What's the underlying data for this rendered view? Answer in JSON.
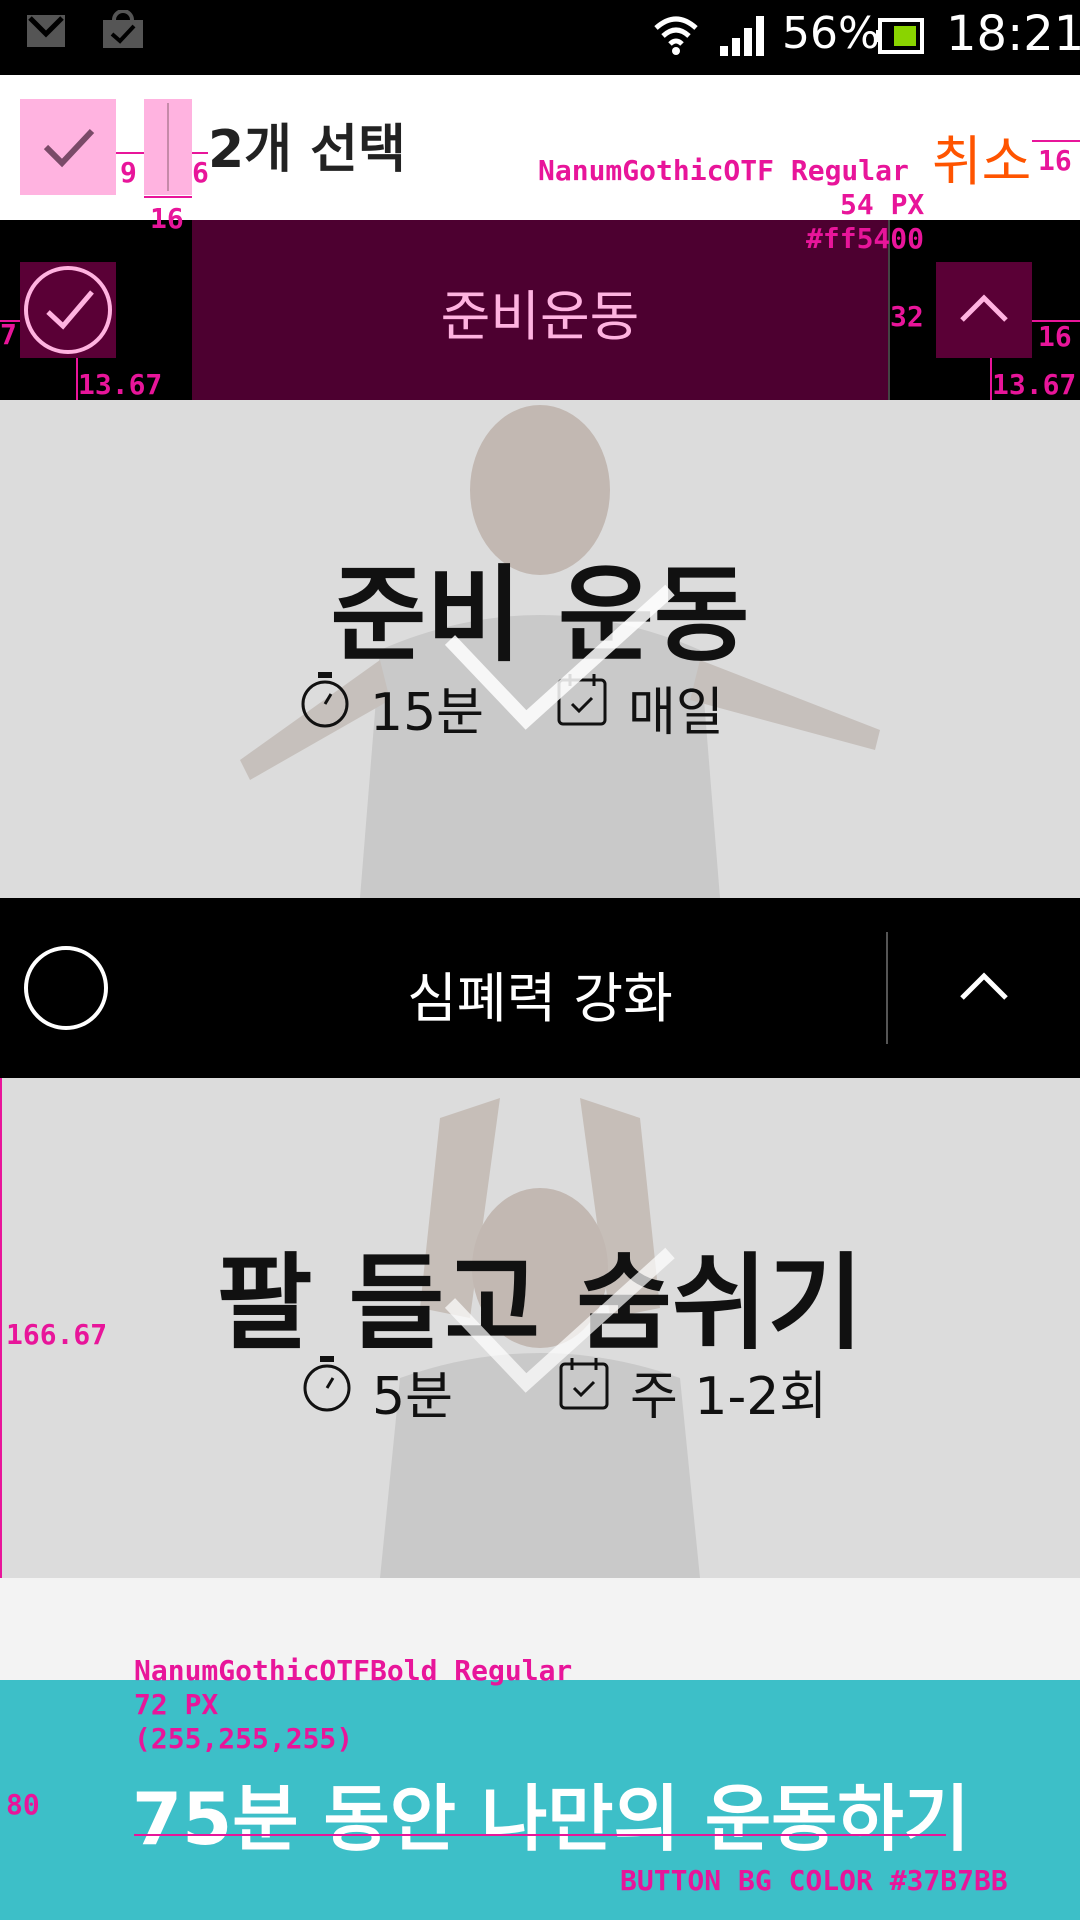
{
  "status_bar": {
    "battery": "56%",
    "time": "18:21",
    "icons": [
      "gmail-icon",
      "shopping-bag-icon",
      "wifi-icon",
      "signal-icon",
      "battery-icon"
    ]
  },
  "selection_bar": {
    "count_label": "2개 선택",
    "cancel_label": "취소",
    "cancel_color": "#ff5400"
  },
  "sections": [
    {
      "header": "준비운동",
      "selected": true,
      "title": "준비 운동",
      "duration": "15분",
      "frequency": "매일"
    },
    {
      "header": "심폐력 강화",
      "selected": false,
      "title": "팔 들고 숨쉬기",
      "duration": "5분",
      "frequency": "주 1-2회"
    }
  ],
  "cta": {
    "label": "75분 동안 나만의 운동하기",
    "bg_color": "#37B7BB"
  },
  "annotations": {
    "m_9": "9",
    "m_6": "6",
    "m_16_left": "16",
    "m_16_cancel": "16",
    "cancel_font": "NanumGothicOTF Regular",
    "cancel_px": "54 PX",
    "cancel_hex": "#ff5400",
    "m_7": "7",
    "m_1367_left": "13.67",
    "m_32": "32",
    "m_16_right": "16",
    "m_1367_right": "13.67",
    "m_16667": "166.67",
    "cta_font": "NanumGothicOTFBold Regular",
    "cta_px": "72 PX",
    "cta_rgb": "(255,255,255)",
    "m_80": "80",
    "button_bg": "BUTTON BG COLOR #37B7BB"
  }
}
